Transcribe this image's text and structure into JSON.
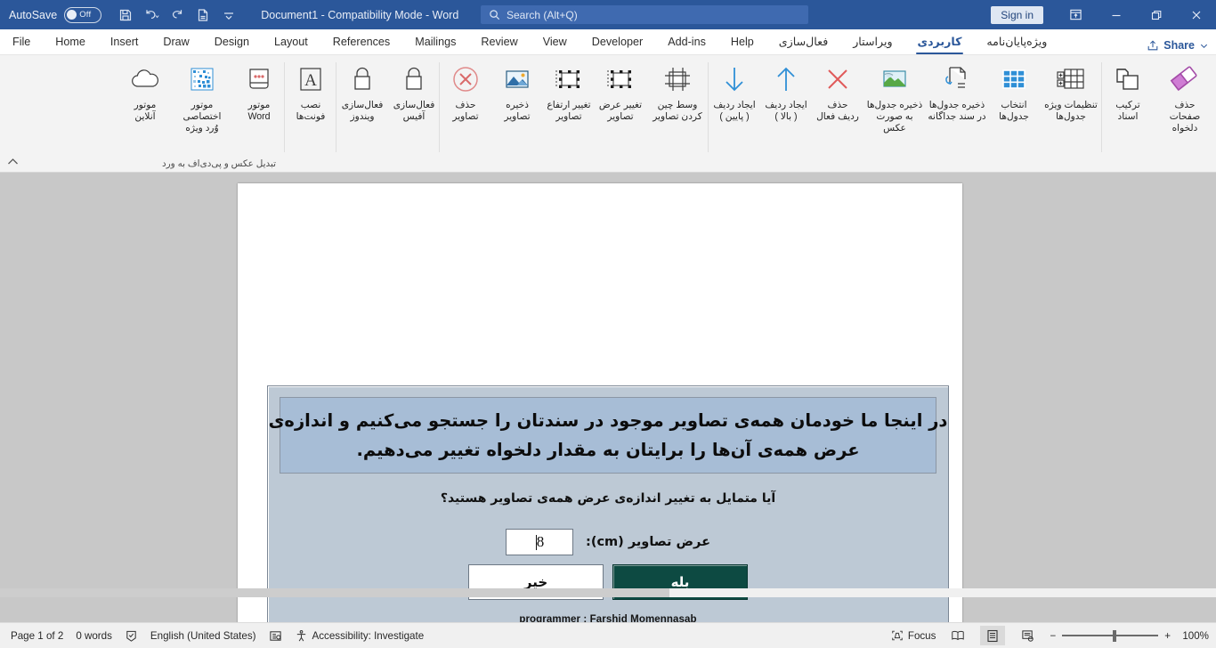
{
  "titlebar": {
    "autosave_label": "AutoSave",
    "autosave_state": "Off",
    "document_title": "Document1  -  Compatibility Mode  -  Word",
    "search_placeholder": "Search (Alt+Q)",
    "sign_in": "Sign in",
    "icons": [
      "save-icon",
      "undo-icon",
      "redo-icon",
      "print-preview-icon",
      "customize-quick-access-icon"
    ],
    "window_buttons": [
      "ribbon-display-options-icon",
      "minimize-icon",
      "restore-icon",
      "close-icon"
    ]
  },
  "tabs": {
    "items": [
      {
        "label": "File",
        "rtl": false,
        "active": false
      },
      {
        "label": "Home",
        "rtl": false,
        "active": false
      },
      {
        "label": "Insert",
        "rtl": false,
        "active": false
      },
      {
        "label": "Draw",
        "rtl": false,
        "active": false
      },
      {
        "label": "Design",
        "rtl": false,
        "active": false
      },
      {
        "label": "Layout",
        "rtl": false,
        "active": false
      },
      {
        "label": "References",
        "rtl": false,
        "active": false
      },
      {
        "label": "Mailings",
        "rtl": false,
        "active": false
      },
      {
        "label": "Review",
        "rtl": false,
        "active": false
      },
      {
        "label": "View",
        "rtl": false,
        "active": false
      },
      {
        "label": "Developer",
        "rtl": false,
        "active": false
      },
      {
        "label": "Add-ins",
        "rtl": false,
        "active": false
      },
      {
        "label": "Help",
        "rtl": false,
        "active": false
      },
      {
        "label": "فعال‌سازی",
        "rtl": true,
        "active": false
      },
      {
        "label": "ویراستار",
        "rtl": true,
        "active": false
      },
      {
        "label": "کاربردی",
        "rtl": true,
        "active": true
      },
      {
        "label": "ویژه‌پایان‌نامه",
        "rtl": true,
        "active": false
      }
    ],
    "share_label": "Share"
  },
  "ribbon": {
    "groups": [
      {
        "label": "",
        "buttons": [
          {
            "name": "delete-custom-pages-button",
            "icon": "eraser-icon",
            "label": "حذف\nصفحات دلخواه",
            "width": "w70"
          },
          {
            "name": "merge-documents-button",
            "icon": "stacked-docs-icon",
            "label": "ترکیب\nاسناد",
            "width": "w58"
          }
        ]
      },
      {
        "label": "",
        "buttons": [
          {
            "name": "table-special-settings-button",
            "icon": "table-settings-icon",
            "label": "تنظیمات ویژه\nجدول‌ها",
            "width": "w70"
          },
          {
            "name": "select-tables-button",
            "icon": "table-blue-icon",
            "label": "انتخاب\nجدول‌ها",
            "width": "w58"
          },
          {
            "name": "save-tables-separate-doc-button",
            "icon": "doc-export-icon",
            "label": "ذخیره جدول‌ها\nدر سند جداگانه",
            "width": "w70"
          },
          {
            "name": "save-tables-as-image-button",
            "icon": "picture-icon",
            "label": "ذخیره جدول‌ها\nبه صورت عکس",
            "width": "w70"
          },
          {
            "name": "delete-active-row-button",
            "icon": "x-red-icon",
            "label": "حذف\nردیف فعال",
            "width": "w58"
          },
          {
            "name": "insert-row-above-button",
            "icon": "arrow-up-icon",
            "label": "ایجاد ردیف\n( بالا )",
            "width": "w58"
          },
          {
            "name": "insert-row-below-button",
            "icon": "arrow-down-icon",
            "label": "ایجاد ردیف\n( پایین )",
            "width": "w58"
          }
        ]
      },
      {
        "label": "",
        "buttons": [
          {
            "name": "center-images-button",
            "icon": "center-align-icon",
            "label": "وسط چین\nکردن تصاویر",
            "width": "w70"
          },
          {
            "name": "change-image-width-button",
            "icon": "resize-width-icon",
            "label": "تغییر عرض\nتصاویر",
            "width": "w58"
          },
          {
            "name": "change-image-height-button",
            "icon": "resize-height-icon",
            "label": "تغییر ارتفاع\nتصاویر",
            "width": "w58"
          },
          {
            "name": "save-images-button",
            "icon": "mountain-image-icon",
            "label": "ذخیره\nتصاویر",
            "width": "w58"
          },
          {
            "name": "delete-images-button",
            "icon": "x-circle-icon",
            "label": "حذف\nتصاویر",
            "width": "w58"
          }
        ]
      },
      {
        "label": "",
        "buttons": [
          {
            "name": "activate-office-button",
            "icon": "lock-icon",
            "label": "فعال‌سازی\nآفیس",
            "width": "w58"
          },
          {
            "name": "activate-windows-button",
            "icon": "lock-icon",
            "label": "فعال‌سازی\nویندوز",
            "width": "w58"
          }
        ]
      },
      {
        "label": "",
        "buttons": [
          {
            "name": "install-fonts-button",
            "icon": "font-a-icon",
            "label": "نصب\nفونت‌ها",
            "width": "w58"
          }
        ]
      },
      {
        "label": "تبدیل عکس و پی‌دی‌اف به ورد",
        "buttons": [
          {
            "name": "word-engine-button",
            "icon": "word-engine-icon",
            "label": "موتور\nWord",
            "width": "w58"
          },
          {
            "name": "dedicated-word-engine-button",
            "icon": "ocr-pixels-icon",
            "label": "موتور اختصاصی\nوُرد ویژه",
            "width": "w70"
          },
          {
            "name": "online-engine-button",
            "icon": "cloud-icon",
            "label": "موتور\nآنلاین",
            "width": "w58"
          }
        ]
      }
    ],
    "collapse_icon": "chevron-up-icon"
  },
  "dialog": {
    "banner_lines": [
      "در اینجا ما خودمان همه‌ی تصاویر موجود در سندتان را جستجو می‌کنیم و اندازه‌ی",
      "عرض همه‌ی آن‌ها را برایتان به مقدار دلخواه تغییر می‌دهیم."
    ],
    "question": "آیا متمایل به تغییر اندازه‌ی عرض همه‌ی تصاویر هستید؟",
    "field_caption": "عرض تصاویر  (cm):",
    "field_value": "8",
    "yes_label": "بله",
    "no_label": "خیر",
    "credit": "programmer :  Farshid  Momennasab",
    "colors": {
      "dialog_bg": "#bdc9d5",
      "banner_bg": "#a7bdd6",
      "yes_button_bg": "#0d4a42",
      "no_button_bg": "#ffffff"
    }
  },
  "statusbar": {
    "page": "Page 1 of 2",
    "words": "0 words",
    "proofing_icon": "proofing-errors-icon",
    "language": "English (United States)",
    "display_settings_icon": "display-settings-icon",
    "accessibility_icon": "accessibility-icon",
    "accessibility": "Accessibility: Investigate",
    "focus": "Focus",
    "view_read_icon": "read-mode-icon",
    "view_print_icon": "print-layout-icon",
    "view_web_icon": "web-layout-icon",
    "zoom_out": "−",
    "zoom_in": "+",
    "zoom_value": "100%"
  }
}
